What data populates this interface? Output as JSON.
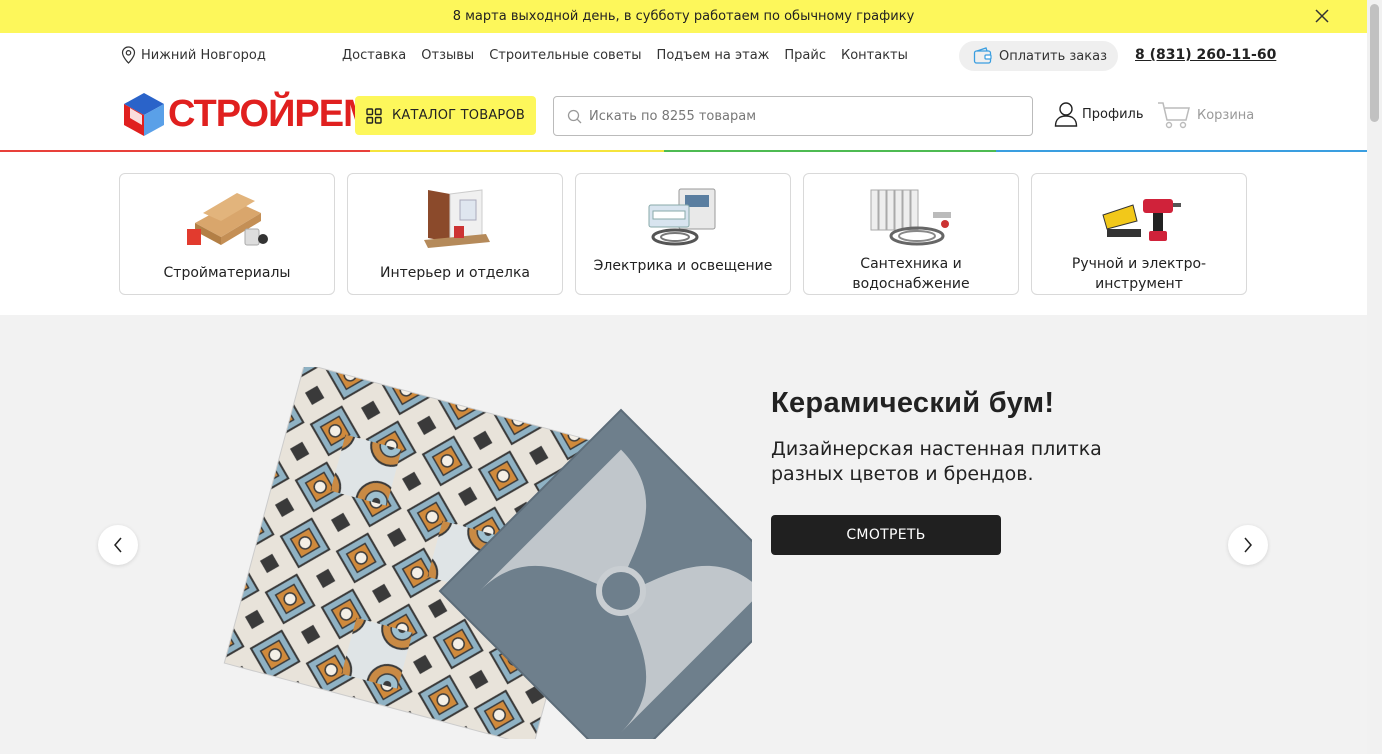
{
  "notice": {
    "text": "8 марта выходной день, в субботу работаем по обычному графику",
    "close_icon": "close-icon"
  },
  "topbar": {
    "city": "Нижний Новгород",
    "nav": [
      "Доставка",
      "Отзывы",
      "Строительные советы",
      "Подъем на этаж",
      "Прайс",
      "Контакты"
    ],
    "pay_button": "Оплатить заказ",
    "phone": "8 (831) 260-11-60"
  },
  "header": {
    "logo_text": "СТРОЙРЕМ",
    "catalog_button": "КАТАЛОГ ТОВАРОВ",
    "search_placeholder": "Искать по 8255 товарам",
    "profile_label": "Профиль",
    "cart_label": "Корзина"
  },
  "categories": [
    {
      "label": "Стройматериалы"
    },
    {
      "label": "Интерьер и отделка"
    },
    {
      "label": "Электрика и освещение"
    },
    {
      "label": "Сантехника и водоснабжение"
    },
    {
      "label": "Ручной и электро-инструмент"
    }
  ],
  "hero": {
    "title": "Керамический бум!",
    "subtitle": "Дизайнерская настенная плитка разных цветов и брендов.",
    "button": "СМОТРЕТЬ"
  },
  "colors": {
    "accent_yellow": "#fdf75b",
    "logo_red": "#e0201f",
    "logo_blue": "#2a63c9",
    "rainbow": [
      "#e8403a",
      "#f5e43c",
      "#4dbb52",
      "#3a9ee0"
    ]
  }
}
